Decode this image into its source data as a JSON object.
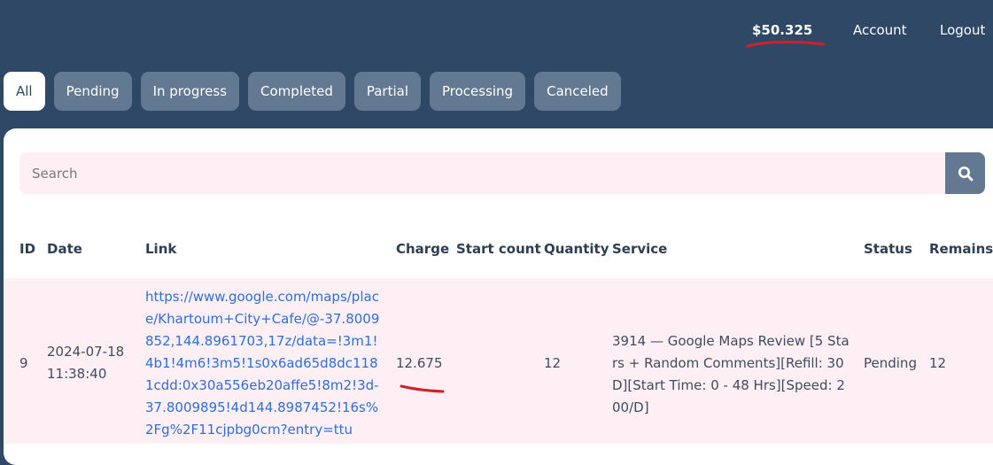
{
  "header": {
    "balance": "$50.325",
    "account_label": "Account",
    "logout_label": "Logout"
  },
  "tabs": [
    {
      "label": "All",
      "active": true
    },
    {
      "label": "Pending",
      "active": false
    },
    {
      "label": "In progress",
      "active": false
    },
    {
      "label": "Completed",
      "active": false
    },
    {
      "label": "Partial",
      "active": false
    },
    {
      "label": "Processing",
      "active": false
    },
    {
      "label": "Canceled",
      "active": false
    }
  ],
  "search": {
    "placeholder": "Search",
    "value": ""
  },
  "table": {
    "headers": {
      "id": "ID",
      "date": "Date",
      "link": "Link",
      "charge": "Charge",
      "start_count": "Start count",
      "quantity": "Quantity",
      "service": "Service",
      "status": "Status",
      "remains": "Remains"
    },
    "rows": [
      {
        "id": "9",
        "date": "2024-07-18",
        "time": "11:38:40",
        "link": "https://www.google.com/maps/place/Khartoum+City+Cafe/@-37.8009852,144.8961703,17z/data=!3m1!4b1!4m6!3m5!1s0x6ad65d8dc1181cdd:0x30a556eb20affe5!8m2!3d-37.8009895!4d144.8987452!16s%2Fg%2F11cjpbg0cm?entry=ttu",
        "charge": "12.675",
        "start_count": "",
        "quantity": "12",
        "service": "3914 — Google Maps Review [5 Stars + Random Comments][Refill: 30D][Start Time: 0 - 48 Hrs][Speed: 200/D]",
        "status": "Pending",
        "remains": "12"
      }
    ]
  },
  "colors": {
    "background": "#2f4865",
    "tab": "#637891",
    "row_highlight": "#fdeff4",
    "link": "#2f6fd6",
    "annotation": "#d0202a"
  }
}
